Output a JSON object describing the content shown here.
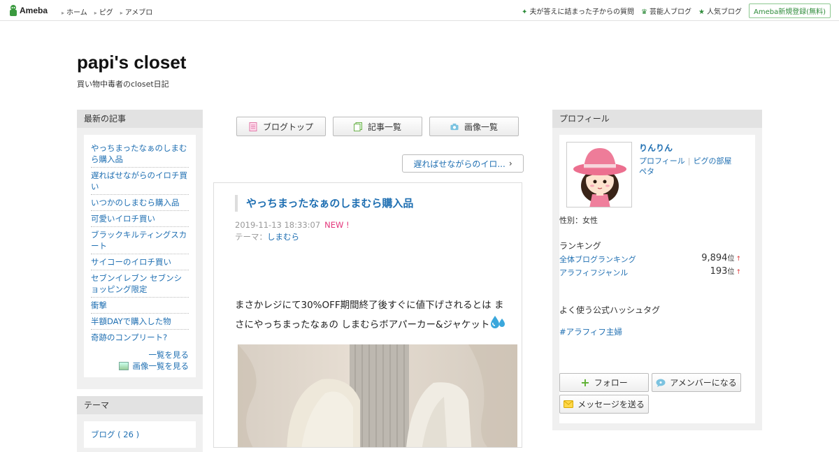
{
  "topbar": {
    "logo": "Ameba",
    "nav": [
      "ホーム",
      "ピグ",
      "アメブロ"
    ],
    "links": [
      "夫が答えに詰まった子からの質問",
      "芸能人ブログ",
      "人気ブログ"
    ],
    "register": "Ameba新規登録(無料)"
  },
  "blog": {
    "title": "papi's closet",
    "description": "買い物中毒者のcloset日記"
  },
  "recent": {
    "heading": "最新の記事",
    "items": [
      "やっちまったなぁのしまむら購入品",
      "遅ればせながらのイロチ買い",
      "いつかのしまむら購入品",
      "可愛いイロチ買い",
      "ブラックキルティングスカート",
      "サイコーのイロチ買い",
      "セブンイレブン セブンショッピング限定",
      "衝撃",
      "半額DAYで購入した物",
      "奇跡のコンプリート?"
    ],
    "more_list": "一覧を見る",
    "more_images": "画像一覧を見る"
  },
  "theme_box": {
    "heading": "テーマ",
    "items": [
      "ブログ ( 26 )"
    ]
  },
  "nav_buttons": {
    "top": "ブログトップ",
    "list": "記事一覧",
    "images": "画像一覧"
  },
  "prev_button": "遅ればせながらのイロ...",
  "article": {
    "title": "やっちまったなぁのしまむら購入品",
    "date": "2019-11-13 18:33:07",
    "new_badge": "NEW !",
    "theme_label": "テーマ：",
    "theme": "しまむら",
    "body_line1": "まさかレジにて30%OFF期間終了後すぐに値下げされるとは ま",
    "body_line2": "さにやっちまったなぁの しまむらボアパーカー&ジャケット"
  },
  "profile": {
    "heading": "プロフィール",
    "name": "りんりん",
    "link_profile": "プロフィール",
    "link_room": "ピグの部屋",
    "link_peta": "ペタ",
    "gender": "性別：女性",
    "ranking_heading": "ランキング",
    "rankings": [
      {
        "label": "全体ブログランキング",
        "value": "9,894",
        "unit": "位"
      },
      {
        "label": "アラフィフジャンル",
        "value": "193",
        "unit": "位"
      }
    ],
    "hashtag_heading": "よく使う公式ハッシュタグ",
    "hashtag": "#アラフィフ主婦",
    "follow": "フォロー",
    "amember": "アメンバーになる",
    "message": "メッセージを送る"
  },
  "colors": {
    "link": "#1f6fb2",
    "new": "#e3357a",
    "ameba_green": "#2e8b3a"
  }
}
